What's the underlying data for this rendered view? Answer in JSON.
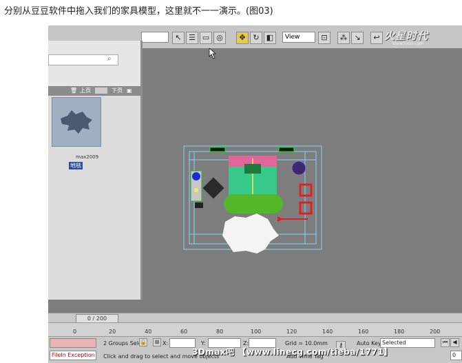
{
  "caption": "分别从豆豆软件中拖入我们的家具模型，这里就不一一演示。(图03)",
  "toolbar": {
    "view_dropdown": "View",
    "logo_text": "火星时代",
    "logo_sub": "www.hxsd.com"
  },
  "left_panel": {
    "nav_prev": "上页",
    "nav_next": "下页",
    "thumb_label": "max2009",
    "thumb_name": "地毯"
  },
  "timeline": {
    "frame_counter": "0 / 200",
    "ticks": [
      "0",
      "20",
      "40",
      "60",
      "80",
      "100",
      "120",
      "140",
      "160",
      "180",
      "200"
    ]
  },
  "status": {
    "error_text": "FileIn Exception",
    "selection_text": "2 Groups Sele",
    "x_label": "X:",
    "y_label": "Y:",
    "z_label": "Z:",
    "grid_text": "Grid = 10.0mm",
    "prompt_text": "Click and drag to select and move objects",
    "add_time_tag": "Add Time Tag",
    "auto_key": "Auto Key",
    "selected_dd": "Selected",
    "spinner_value": "0"
  },
  "watermark": "3Dmax吧 【www.linecg.com/tieba/1771】"
}
